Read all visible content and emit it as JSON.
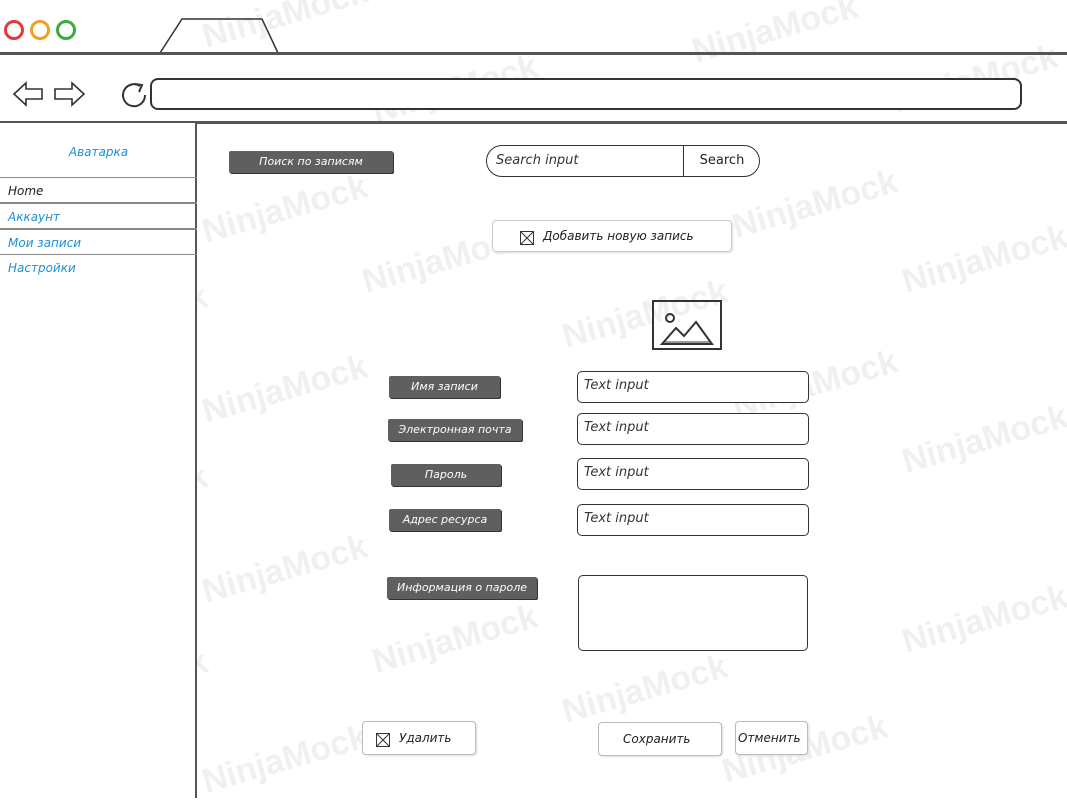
{
  "sidebar": {
    "title": "Аватарка",
    "items": [
      {
        "label": "Home"
      },
      {
        "label": "Аккаунт"
      },
      {
        "label": "Мои записи"
      },
      {
        "label": "Настройки"
      }
    ]
  },
  "toolbar": {
    "search_records_label": "Поиск по записям",
    "search_placeholder": "Search input",
    "search_button": "Search",
    "add_record_label": "Добавить новую запись"
  },
  "form": {
    "fields": [
      {
        "label": "Имя записи",
        "placeholder": "Text input"
      },
      {
        "label": "Электронная почта",
        "placeholder": "Text input"
      },
      {
        "label": "Пароль",
        "placeholder": "Text input"
      },
      {
        "label": "Адрес ресурса",
        "placeholder": "Text input"
      }
    ],
    "password_info_label": "Информация о пароле"
  },
  "actions": {
    "delete_label": "Удалить",
    "save_label": "Сохранить",
    "cancel_label": "Отменить"
  },
  "watermark": "NinjaMock",
  "colors": {
    "accent_blue": "#1d8fd6",
    "label_bg": "#5f5f5f",
    "traffic_red": "#e53935",
    "traffic_orange": "#f0a020",
    "traffic_green": "#3caa3c"
  }
}
